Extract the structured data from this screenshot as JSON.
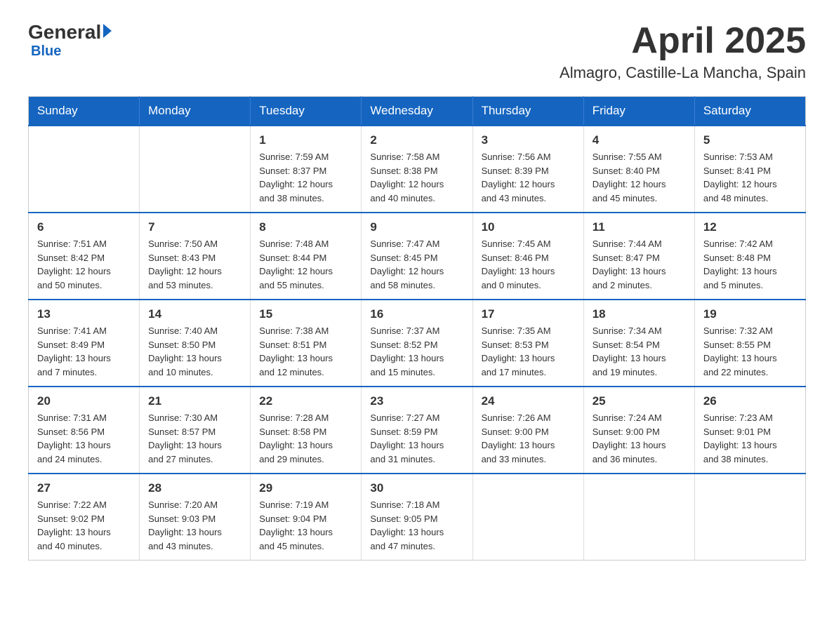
{
  "logo": {
    "general": "General",
    "blue": "Blue",
    "arrow": "▶"
  },
  "title": "April 2025",
  "subtitle": "Almagro, Castille-La Mancha, Spain",
  "days_header": [
    "Sunday",
    "Monday",
    "Tuesday",
    "Wednesday",
    "Thursday",
    "Friday",
    "Saturday"
  ],
  "weeks": [
    [
      {
        "day": "",
        "info": ""
      },
      {
        "day": "",
        "info": ""
      },
      {
        "day": "1",
        "info": "Sunrise: 7:59 AM\nSunset: 8:37 PM\nDaylight: 12 hours\nand 38 minutes."
      },
      {
        "day": "2",
        "info": "Sunrise: 7:58 AM\nSunset: 8:38 PM\nDaylight: 12 hours\nand 40 minutes."
      },
      {
        "day": "3",
        "info": "Sunrise: 7:56 AM\nSunset: 8:39 PM\nDaylight: 12 hours\nand 43 minutes."
      },
      {
        "day": "4",
        "info": "Sunrise: 7:55 AM\nSunset: 8:40 PM\nDaylight: 12 hours\nand 45 minutes."
      },
      {
        "day": "5",
        "info": "Sunrise: 7:53 AM\nSunset: 8:41 PM\nDaylight: 12 hours\nand 48 minutes."
      }
    ],
    [
      {
        "day": "6",
        "info": "Sunrise: 7:51 AM\nSunset: 8:42 PM\nDaylight: 12 hours\nand 50 minutes."
      },
      {
        "day": "7",
        "info": "Sunrise: 7:50 AM\nSunset: 8:43 PM\nDaylight: 12 hours\nand 53 minutes."
      },
      {
        "day": "8",
        "info": "Sunrise: 7:48 AM\nSunset: 8:44 PM\nDaylight: 12 hours\nand 55 minutes."
      },
      {
        "day": "9",
        "info": "Sunrise: 7:47 AM\nSunset: 8:45 PM\nDaylight: 12 hours\nand 58 minutes."
      },
      {
        "day": "10",
        "info": "Sunrise: 7:45 AM\nSunset: 8:46 PM\nDaylight: 13 hours\nand 0 minutes."
      },
      {
        "day": "11",
        "info": "Sunrise: 7:44 AM\nSunset: 8:47 PM\nDaylight: 13 hours\nand 2 minutes."
      },
      {
        "day": "12",
        "info": "Sunrise: 7:42 AM\nSunset: 8:48 PM\nDaylight: 13 hours\nand 5 minutes."
      }
    ],
    [
      {
        "day": "13",
        "info": "Sunrise: 7:41 AM\nSunset: 8:49 PM\nDaylight: 13 hours\nand 7 minutes."
      },
      {
        "day": "14",
        "info": "Sunrise: 7:40 AM\nSunset: 8:50 PM\nDaylight: 13 hours\nand 10 minutes."
      },
      {
        "day": "15",
        "info": "Sunrise: 7:38 AM\nSunset: 8:51 PM\nDaylight: 13 hours\nand 12 minutes."
      },
      {
        "day": "16",
        "info": "Sunrise: 7:37 AM\nSunset: 8:52 PM\nDaylight: 13 hours\nand 15 minutes."
      },
      {
        "day": "17",
        "info": "Sunrise: 7:35 AM\nSunset: 8:53 PM\nDaylight: 13 hours\nand 17 minutes."
      },
      {
        "day": "18",
        "info": "Sunrise: 7:34 AM\nSunset: 8:54 PM\nDaylight: 13 hours\nand 19 minutes."
      },
      {
        "day": "19",
        "info": "Sunrise: 7:32 AM\nSunset: 8:55 PM\nDaylight: 13 hours\nand 22 minutes."
      }
    ],
    [
      {
        "day": "20",
        "info": "Sunrise: 7:31 AM\nSunset: 8:56 PM\nDaylight: 13 hours\nand 24 minutes."
      },
      {
        "day": "21",
        "info": "Sunrise: 7:30 AM\nSunset: 8:57 PM\nDaylight: 13 hours\nand 27 minutes."
      },
      {
        "day": "22",
        "info": "Sunrise: 7:28 AM\nSunset: 8:58 PM\nDaylight: 13 hours\nand 29 minutes."
      },
      {
        "day": "23",
        "info": "Sunrise: 7:27 AM\nSunset: 8:59 PM\nDaylight: 13 hours\nand 31 minutes."
      },
      {
        "day": "24",
        "info": "Sunrise: 7:26 AM\nSunset: 9:00 PM\nDaylight: 13 hours\nand 33 minutes."
      },
      {
        "day": "25",
        "info": "Sunrise: 7:24 AM\nSunset: 9:00 PM\nDaylight: 13 hours\nand 36 minutes."
      },
      {
        "day": "26",
        "info": "Sunrise: 7:23 AM\nSunset: 9:01 PM\nDaylight: 13 hours\nand 38 minutes."
      }
    ],
    [
      {
        "day": "27",
        "info": "Sunrise: 7:22 AM\nSunset: 9:02 PM\nDaylight: 13 hours\nand 40 minutes."
      },
      {
        "day": "28",
        "info": "Sunrise: 7:20 AM\nSunset: 9:03 PM\nDaylight: 13 hours\nand 43 minutes."
      },
      {
        "day": "29",
        "info": "Sunrise: 7:19 AM\nSunset: 9:04 PM\nDaylight: 13 hours\nand 45 minutes."
      },
      {
        "day": "30",
        "info": "Sunrise: 7:18 AM\nSunset: 9:05 PM\nDaylight: 13 hours\nand 47 minutes."
      },
      {
        "day": "",
        "info": ""
      },
      {
        "day": "",
        "info": ""
      },
      {
        "day": "",
        "info": ""
      }
    ]
  ]
}
